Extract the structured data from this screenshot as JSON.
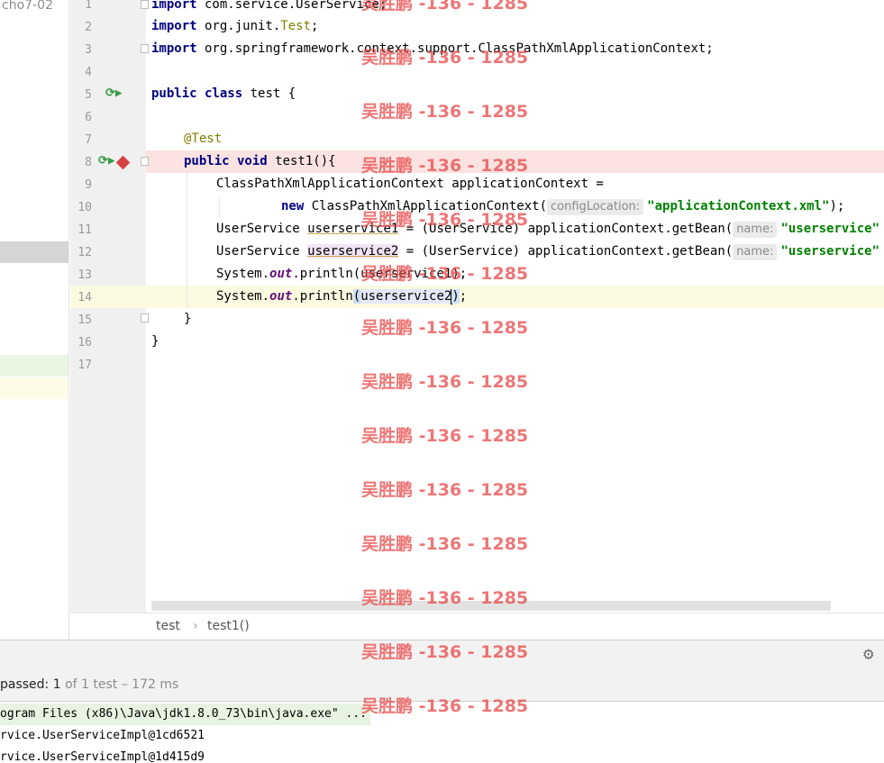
{
  "project": {
    "label": "cho7-02"
  },
  "gutter": {
    "line_numbers": [
      "1",
      "2",
      "3",
      "4",
      "5",
      "6",
      "7",
      "8",
      "9",
      "10",
      "11",
      "12",
      "13",
      "14",
      "15",
      "16",
      "17"
    ]
  },
  "code": {
    "l1": {
      "kw": "import",
      "text": " com.service.UserService;"
    },
    "l2": {
      "kw": "import",
      "pre": " org.junit.",
      "ann": "Test",
      "post": ";"
    },
    "l3": {
      "kw": "import",
      "text": " org.springframework.context.support.ClassPathXmlApplicationContext;"
    },
    "l5": {
      "kw": "public class",
      "text": " test {"
    },
    "l7": {
      "ann": "@Test"
    },
    "l8": {
      "kw": "public void",
      "text": " test1(){"
    },
    "l9": {
      "text": "ClassPathXmlApplicationContext applicationContext ="
    },
    "l10": {
      "kw": "new",
      "text": " ClassPathXmlApplicationContext(",
      "hint": "configLocation:",
      "str": "\"applicationContext.xml\"",
      "post": ");"
    },
    "l11": {
      "type": "UserService ",
      "var": "userservice1",
      "mid": " = (UserService) applicationContext.getBean(",
      "hint": "name:",
      "str": "\"userservice\""
    },
    "l12": {
      "type": "UserService ",
      "var": "userservice2",
      "mid": " = (UserService) applicationContext.getBean(",
      "hint": "name:",
      "str": "\"userservice\""
    },
    "l13": {
      "pre": "System.",
      "static": "out",
      "post": ".println(userservice1);"
    },
    "l14": {
      "pre": "System.",
      "static": "out",
      "mid": ".println",
      "open": "(",
      "arg": "userservice2",
      "close": ")",
      "post": ";"
    },
    "l15": {
      "text": "}"
    },
    "l16": {
      "text": "}"
    }
  },
  "breadcrumb": {
    "items": [
      "test",
      "test1()"
    ],
    "separator": "›"
  },
  "run": {
    "status_strong": "passed: 1",
    "status_rest": " of 1 test – 172 ms",
    "console": [
      "ogram Files (x86)\\Java\\jdk1.8.0_73\\bin\\java.exe\" ...",
      "rvice.UserServiceImpl@1cd6521",
      "rvice.UserServiceImpl@1d415d9"
    ]
  },
  "watermark": {
    "text": "吴胜鹏 -136 - 1285"
  },
  "icons": {
    "run": "run-test-icon",
    "breakpoint": "breakpoint-icon",
    "settings": "gear-icon",
    "fold": "fold-icon"
  },
  "colors": {
    "keyword": "#000080",
    "annotation": "#808000",
    "string": "#008000",
    "static_field": "#660e7a",
    "breakpoint_line": "#fae3e1",
    "watermark": "#e84848"
  }
}
